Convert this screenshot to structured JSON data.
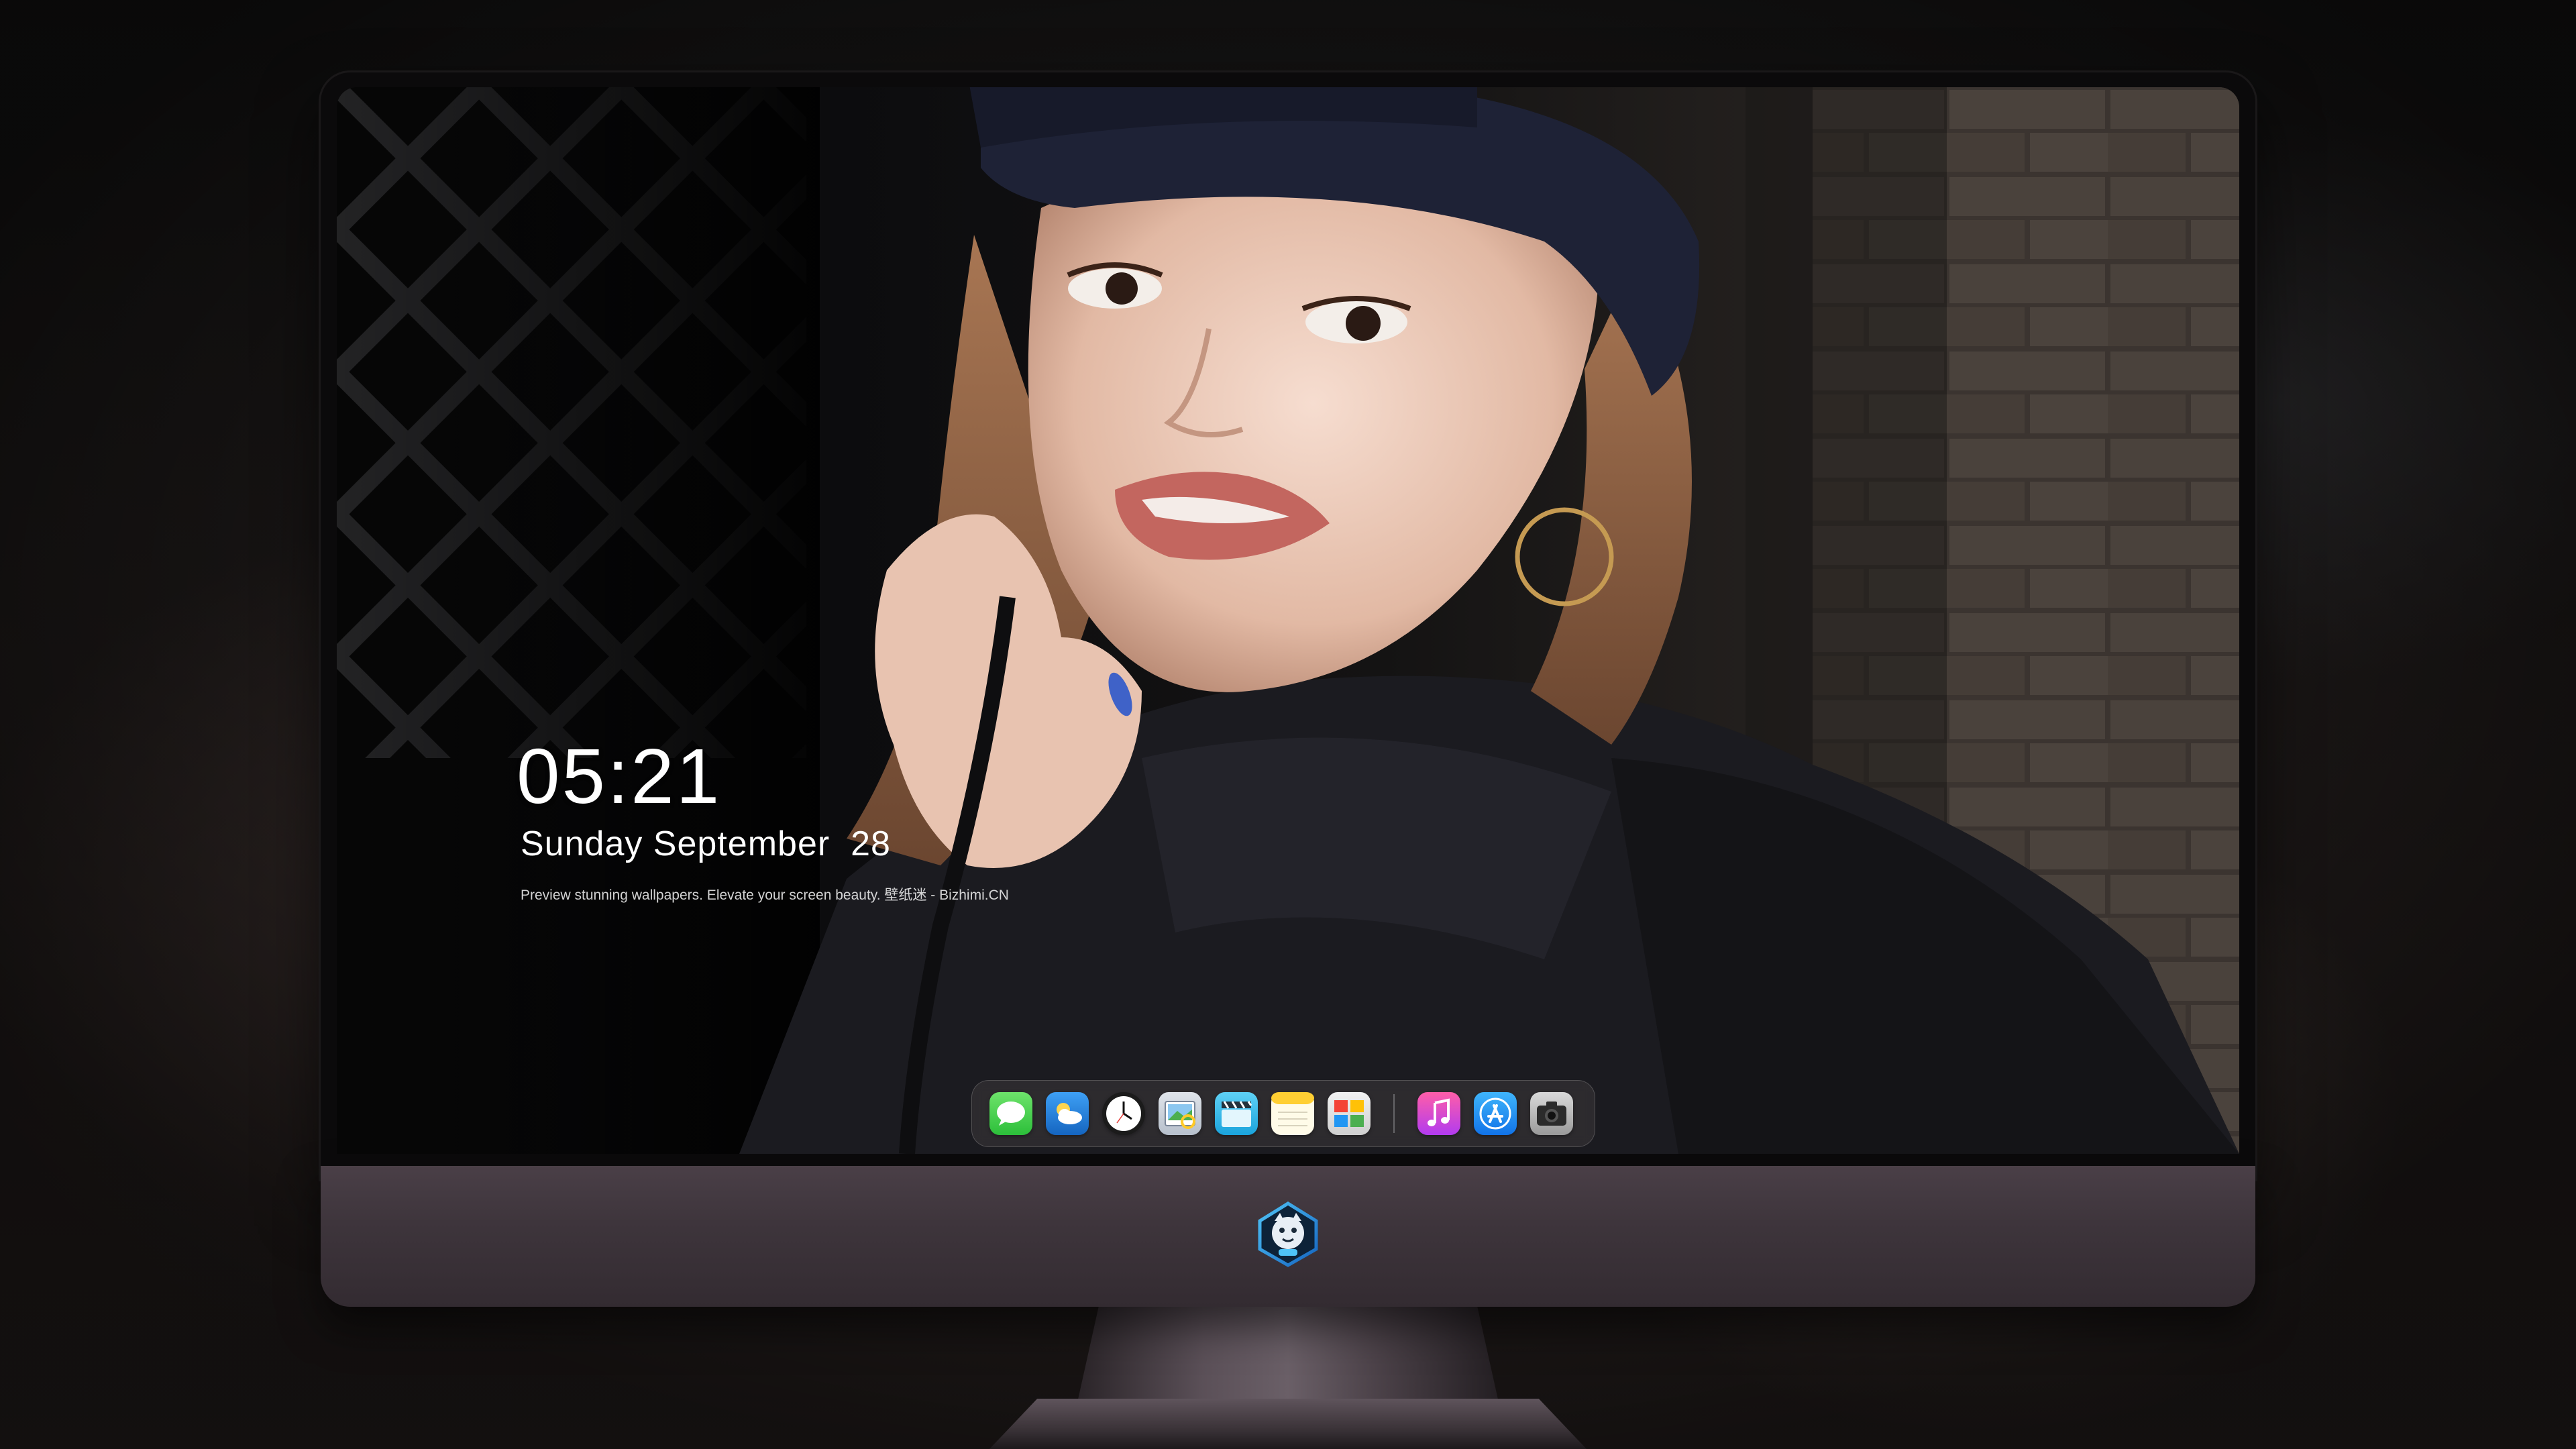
{
  "lockscreen": {
    "time": "05:21",
    "date": "Sunday September  28",
    "tagline": "Preview stunning wallpapers. Elevate your screen beauty. 壁纸迷 - Bizhimi.CN"
  },
  "dock": {
    "apps": [
      {
        "name": "Messages",
        "icon": "messages-icon"
      },
      {
        "name": "Weather",
        "icon": "weather-icon"
      },
      {
        "name": "Clock",
        "icon": "clock-icon"
      },
      {
        "name": "Preview",
        "icon": "preview-icon"
      },
      {
        "name": "Clips",
        "icon": "clapperboard-icon"
      },
      {
        "name": "Notes",
        "icon": "notes-icon"
      },
      {
        "name": "Photo Booth",
        "icon": "photo-booth-icon"
      },
      {
        "name": "iTunes",
        "icon": "music-note-icon"
      },
      {
        "name": "App Store",
        "icon": "app-store-icon"
      },
      {
        "name": "Camera",
        "icon": "camera-icon"
      }
    ]
  },
  "colors": {
    "chin": "#3e353c",
    "bezel": "#0b0a0b",
    "dock_bg": "rgba(60,56,58,0.55)"
  }
}
